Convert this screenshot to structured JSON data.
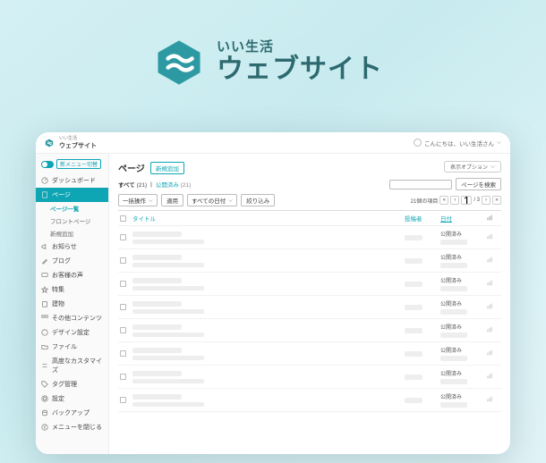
{
  "brand": {
    "sub": "いい生活",
    "main": "ウェブサイト"
  },
  "topbar": {
    "product": "ウェブサイト",
    "product_sub": "いい生活",
    "greeting": "こんにちは、いい生活さん"
  },
  "options_label": "表示オプション",
  "sidebar": {
    "toggle_label": "新メニュー切替",
    "items": [
      {
        "label": "ダッシュボード"
      },
      {
        "label": "ページ"
      },
      {
        "label": "お知らせ"
      },
      {
        "label": "ブログ"
      },
      {
        "label": "お客様の声"
      },
      {
        "label": "特集"
      },
      {
        "label": "建物"
      },
      {
        "label": "その他コンテンツ"
      },
      {
        "label": "デザイン設定"
      },
      {
        "label": "ファイル"
      },
      {
        "label": "高度なカスタマイズ"
      },
      {
        "label": "タグ管理"
      },
      {
        "label": "設定"
      },
      {
        "label": "バックアップ"
      },
      {
        "label": "メニューを閉じる"
      }
    ],
    "subs": [
      {
        "label": "ページ一覧"
      },
      {
        "label": "フロントページ"
      },
      {
        "label": "新規追加"
      }
    ]
  },
  "page": {
    "title": "ページ",
    "new_btn": "新規追加",
    "tabs": {
      "all": "すべて",
      "all_count": "(21)",
      "published": "公開済み",
      "pub_count": "(21)"
    },
    "bulk_select": "一括操作",
    "apply": "適用",
    "date_select": "すべての日付",
    "filter": "絞り込み",
    "search_btn": "ページを検索",
    "item_count": "21個の項目",
    "page_total": "/ 3",
    "cols": {
      "title": "タイトル",
      "author": "投稿者",
      "date": "日付"
    },
    "row_status": "公開済み"
  }
}
